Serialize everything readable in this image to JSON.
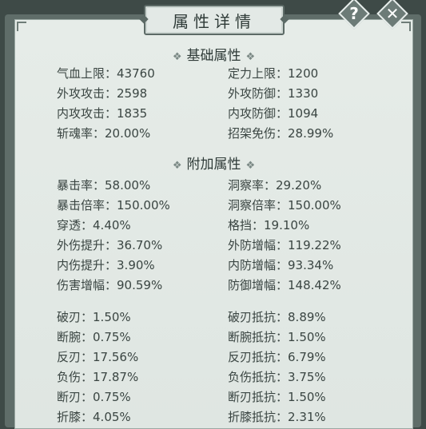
{
  "window": {
    "title": "属性详情"
  },
  "buttons": {
    "help_glyph": "?",
    "close_glyph": "✕"
  },
  "sections": {
    "base": "基础属性",
    "extra": "附加属性",
    "diamond": "❖"
  },
  "base_stats": [
    {
      "left": {
        "label": "气血上限：",
        "value": "43760"
      },
      "right": {
        "label": "定力上限：",
        "value": "1200"
      }
    },
    {
      "left": {
        "label": "外攻攻击：",
        "value": "2598"
      },
      "right": {
        "label": "外攻防御：",
        "value": "1330"
      }
    },
    {
      "left": {
        "label": "内攻攻击：",
        "value": "1835"
      },
      "right": {
        "label": "内攻防御：",
        "value": "1094"
      }
    },
    {
      "left": {
        "label": "斩魂率：",
        "value": "20.00%"
      },
      "right": {
        "label": "招架免伤：",
        "value": "28.99%"
      }
    }
  ],
  "extra_stats": [
    {
      "left": {
        "label": "暴击率：",
        "value": "58.00%"
      },
      "right": {
        "label": "洞察率：",
        "value": "29.20%"
      }
    },
    {
      "left": {
        "label": "暴击倍率：",
        "value": "150.00%"
      },
      "right": {
        "label": "洞察倍率：",
        "value": "150.00%"
      }
    },
    {
      "left": {
        "label": "穿透：",
        "value": "4.40%"
      },
      "right": {
        "label": "格挡：",
        "value": "19.10%"
      }
    },
    {
      "left": {
        "label": "外伤提升：",
        "value": "36.70%"
      },
      "right": {
        "label": "外防增幅：",
        "value": "119.22%"
      }
    },
    {
      "left": {
        "label": "内伤提升：",
        "value": "3.90%"
      },
      "right": {
        "label": "内防增幅：",
        "value": "93.34%"
      }
    },
    {
      "left": {
        "label": "伤害增幅：",
        "value": "90.59%"
      },
      "right": {
        "label": "防御增幅：",
        "value": "148.42%"
      }
    }
  ],
  "special_stats": [
    {
      "left": {
        "label": "破刃：",
        "value": "1.50%"
      },
      "right": {
        "label": "破刃抵抗：",
        "value": "8.89%"
      }
    },
    {
      "left": {
        "label": "断腕：",
        "value": "0.75%"
      },
      "right": {
        "label": "断腕抵抗：",
        "value": "1.50%"
      }
    },
    {
      "left": {
        "label": "反刃：",
        "value": "17.56%"
      },
      "right": {
        "label": "反刃抵抗：",
        "value": "6.79%"
      }
    },
    {
      "left": {
        "label": "负伤：",
        "value": "17.87%"
      },
      "right": {
        "label": "负伤抵抗：",
        "value": "3.75%"
      }
    },
    {
      "left": {
        "label": "断刃：",
        "value": "0.75%"
      },
      "right": {
        "label": "断刃抵抗：",
        "value": "1.50%"
      }
    },
    {
      "left": {
        "label": "折膝：",
        "value": "4.05%"
      },
      "right": {
        "label": "折膝抵抗：",
        "value": "2.31%"
      }
    }
  ]
}
